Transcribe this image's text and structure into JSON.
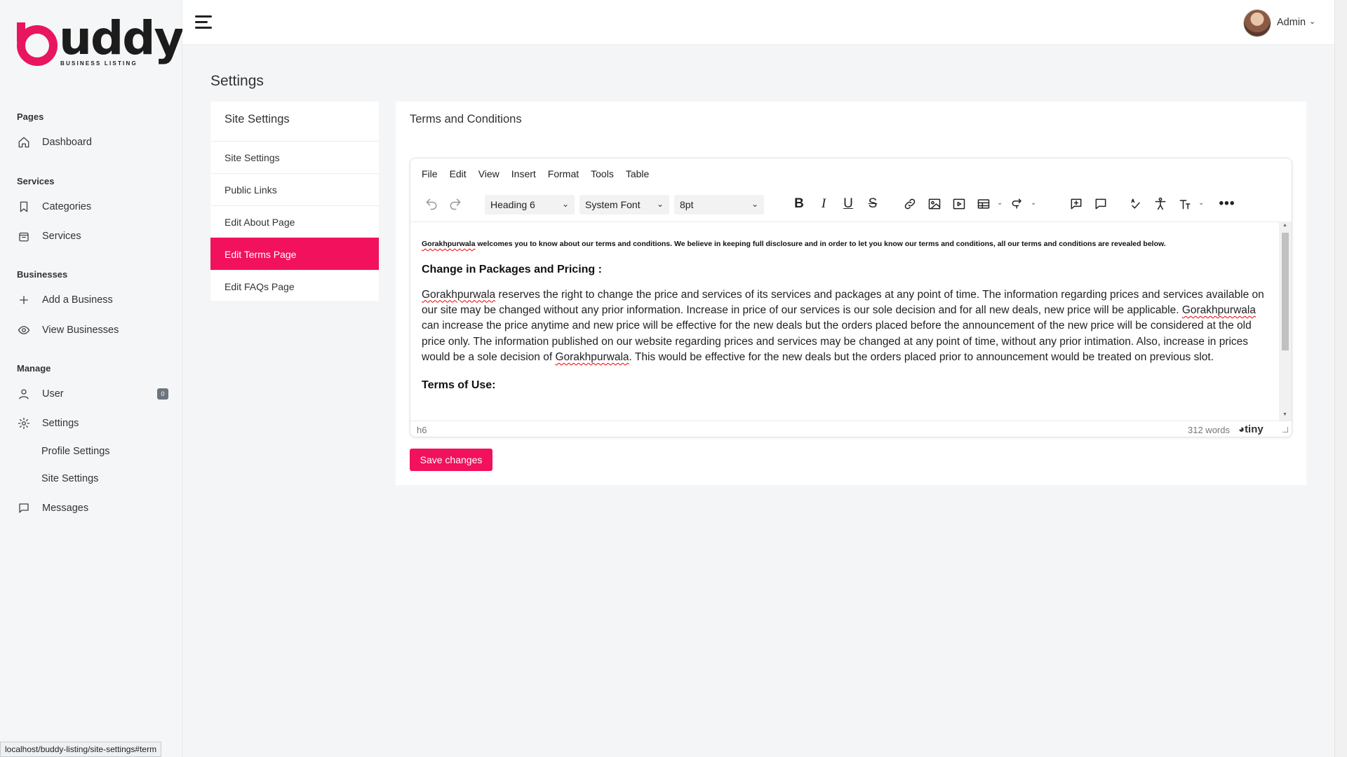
{
  "brand": {
    "word": "buddy",
    "tagline": "BUSINESS LISTING",
    "accent": "#f2115d"
  },
  "sidebar": {
    "sections": [
      {
        "title": "Pages"
      },
      {
        "title": "Services"
      },
      {
        "title": "Businesses"
      },
      {
        "title": "Manage"
      }
    ],
    "items": {
      "dashboard": "Dashboard",
      "categories": "Categories",
      "services": "Services",
      "add_business": "Add a Business",
      "view_businesses": "View Businesses",
      "user": "User",
      "user_badge": "0",
      "settings": "Settings",
      "profile_settings": "Profile Settings",
      "site_settings": "Site Settings",
      "messages": "Messages"
    }
  },
  "topbar": {
    "user_name": "Admin"
  },
  "page": {
    "title": "Settings"
  },
  "settings_menu": {
    "heading": "Site Settings",
    "items": [
      "Site Settings",
      "Public Links",
      "Edit About Page",
      "Edit Terms Page",
      "Edit FAQs Page"
    ],
    "active": "Edit Terms Page"
  },
  "editor_card": {
    "title": "Terms and Conditions",
    "menubar": [
      "File",
      "Edit",
      "View",
      "Insert",
      "Format",
      "Tools",
      "Table"
    ],
    "block_format": "Heading 6",
    "font_family": "System Font",
    "font_size": "8pt",
    "content": {
      "lead_word": "Gorakhpurwala",
      "lead_rest": " welcomes you to know about our terms and conditions. We believe in keeping full disclosure and in order to let you know our terms and conditions, all our terms and conditions are revealed below.",
      "heading1": "Change in Packages and Pricing :",
      "p1_a": "Gorakhpurwala",
      "p1_b": " reserves the right to change the price and services of its services and packages at any point of time. The information regarding prices and services available on our site may be changed without any prior information. Increase in price of our services is our sole decision and for all new deals, new price will be applicable. ",
      "p1_c": "Gorakhpurwala",
      "p1_d": " can increase the price anytime and new price will be effective for the new deals but the orders placed before the announcement of the new price will be considered at the old price only. The information published on our website regarding prices and services may be changed at any point of time, without any prior intimation. Also, increase in prices would be a sole decision of ",
      "p1_e": "Gorakhpurwala",
      "p1_f": ". This would be effective for the new deals but the orders placed prior to announcement would be treated on previous slot.",
      "heading2": "Terms of Use:"
    },
    "status_path": "h6",
    "word_count": "312 words",
    "powered_by": "tiny",
    "save_label": "Save changes"
  },
  "status_url": "localhost/buddy-listing/site-settings#term",
  "icons": {
    "undo": "undo-icon",
    "redo": "redo-icon",
    "bold": "bold-icon",
    "italic": "italic-icon",
    "underline": "underline-icon",
    "strike": "strikethrough-icon",
    "link": "link-icon",
    "image": "image-icon",
    "media": "media-icon",
    "table": "table-icon",
    "export": "export-icon",
    "add_comment": "add-comment-icon",
    "comments": "comments-icon",
    "spellcheck": "spellcheck-icon",
    "accessibility": "accessibility-icon",
    "text_format": "text-format-icon",
    "more": "more-icon"
  }
}
